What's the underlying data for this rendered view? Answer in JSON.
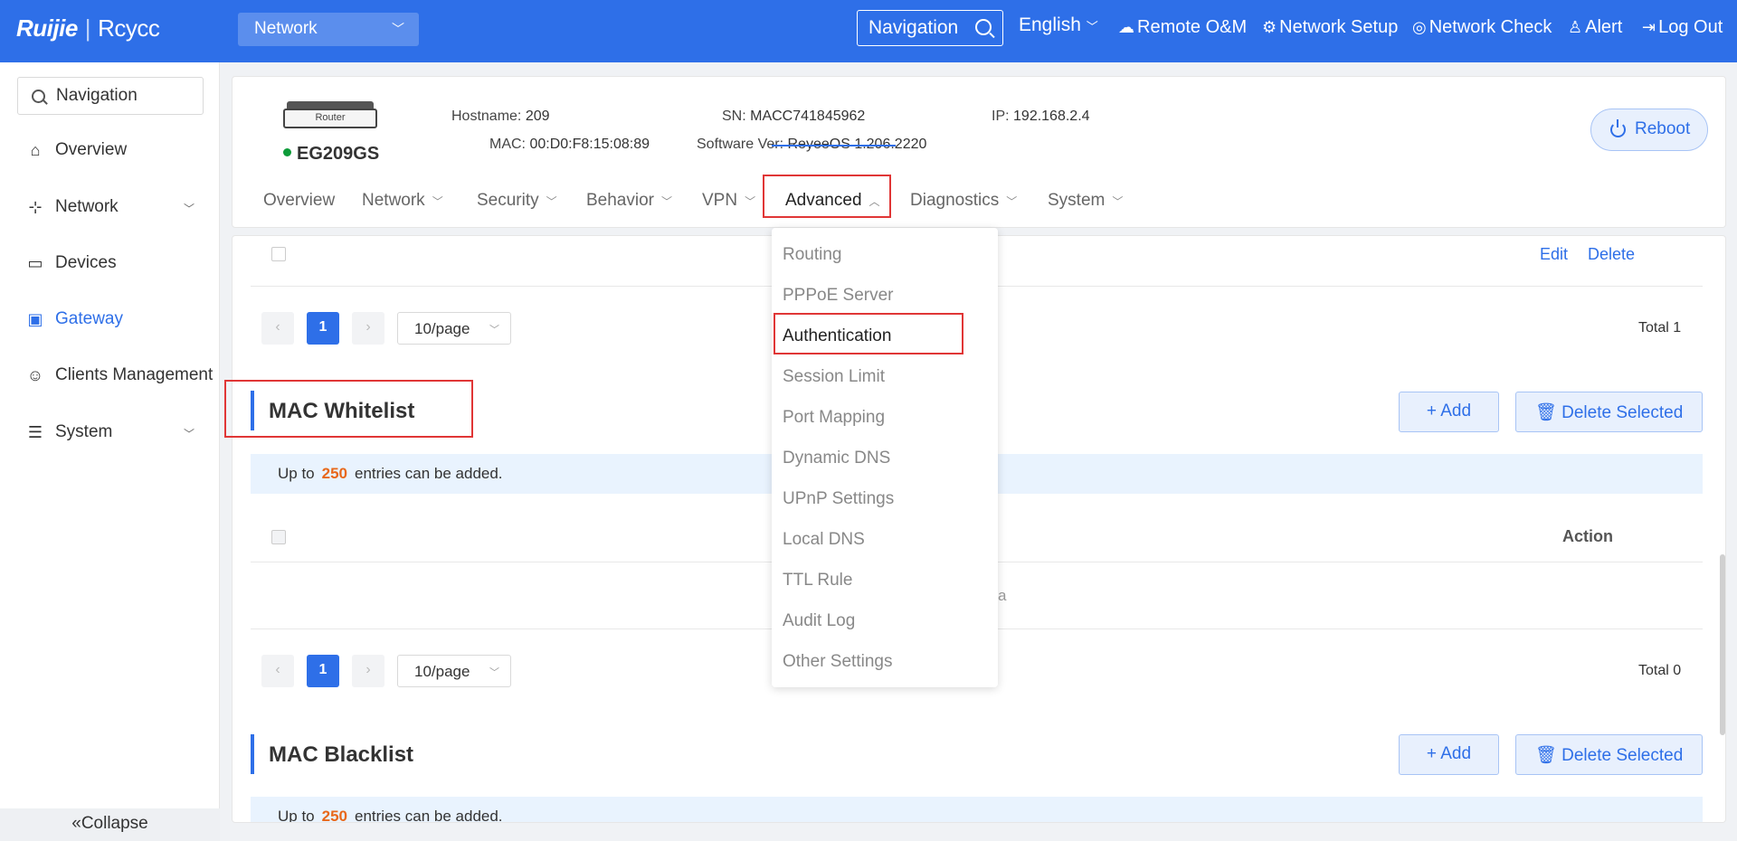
{
  "topbar": {
    "logo": "Ruijie",
    "logo_sub": "Rcycc",
    "network_select": "Network",
    "navigation": "Navigation",
    "language": "English",
    "links": [
      "Remote O&M",
      "Network Setup",
      "Network Check",
      "Alert",
      "Log Out"
    ]
  },
  "sidebar": {
    "search_placeholder": "Navigation",
    "items": [
      {
        "label": "Overview"
      },
      {
        "label": "Network"
      },
      {
        "label": "Devices"
      },
      {
        "label": "Gateway"
      },
      {
        "label": "Clients Management"
      },
      {
        "label": "System"
      }
    ],
    "collapse": "Collapse"
  },
  "device": {
    "image_label": "Router",
    "model": "EG209GS",
    "hostname_label": "Hostname:",
    "hostname": "209",
    "mac_label": "MAC:",
    "mac": "00:D0:F8:15:08:89",
    "sn_label": "SN:",
    "sn": "MACC741845962",
    "software_label": "Software Ver:",
    "software": "ReyeeOS 1.206.2220",
    "ip_label": "IP:",
    "ip": "192.168.2.4",
    "reboot": "Reboot",
    "tabs": [
      "Overview",
      "Network",
      "Security",
      "Behavior",
      "VPN",
      "Advanced",
      "Diagnostics",
      "System"
    ]
  },
  "dropdown": {
    "items": [
      "Routing",
      "PPPoE Server",
      "Authentication",
      "Session Limit",
      "Port Mapping",
      "Dynamic DNS",
      "UPnP Settings",
      "Local DNS",
      "TTL Rule",
      "Audit Log",
      "Other Settings"
    ]
  },
  "main": {
    "edit": "Edit",
    "delete": "Delete",
    "page": "1",
    "page_size": "10/page",
    "total_top": "Total 1",
    "total_mid": "Total 0",
    "whitelist_title": "MAC Whitelist",
    "blacklist_title": "MAC Blacklist",
    "add": "+ Add",
    "delete_selected": "Delete Selected",
    "notice_pre": "Up to",
    "notice_num": "250",
    "notice_post": "entries can be added.",
    "action_col": "Action",
    "no_data_fragment": "a"
  }
}
